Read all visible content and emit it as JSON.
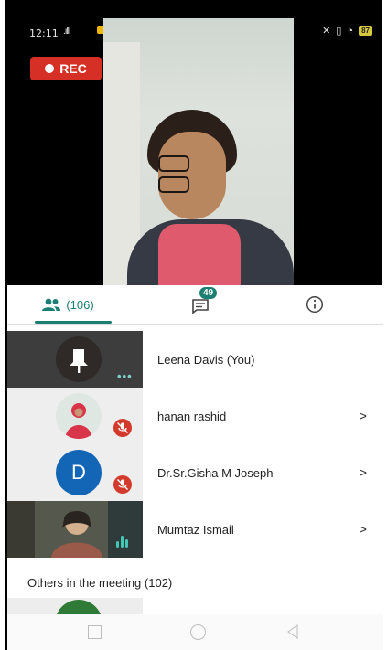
{
  "status_bar": {
    "time": "12:11",
    "signal": ".ıll",
    "battery": "87"
  },
  "recording": {
    "label": "REC"
  },
  "tabs": {
    "people_count": "(106)",
    "chat_badge": "49"
  },
  "participants": [
    {
      "name": "Leena Davis (You)",
      "state": "speaking-menu",
      "has_chevron": false
    },
    {
      "name": "hanan rashid",
      "state": "muted",
      "has_chevron": true
    },
    {
      "name": "Dr.Sr.Gisha M Joseph",
      "avatar_letter": "D",
      "state": "muted",
      "has_chevron": true
    },
    {
      "name": "Mumtaz Ismail",
      "state": "speaking",
      "has_chevron": true
    }
  ],
  "chevron": ">",
  "others": {
    "label": "Others in the meeting (102)"
  },
  "colors": {
    "accent": "#1b7f72",
    "rec": "#d63026",
    "mute": "#d23a2c",
    "avatar_d": "#1366b5"
  },
  "icons": [
    "people-icon",
    "chat-icon",
    "info-icon",
    "mic-off-icon",
    "more-dots-icon",
    "speaking-icon",
    "pin-icon"
  ]
}
